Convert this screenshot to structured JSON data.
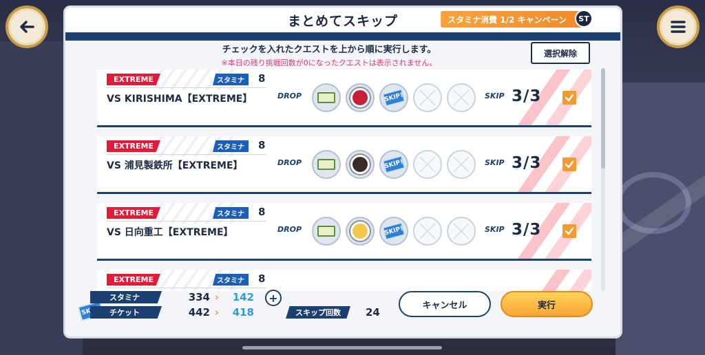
{
  "dialog": {
    "title": "まとめてスキップ",
    "campaign_badge": "スタミナ消費 1/2 キャンペーン",
    "campaign_st": "ST",
    "instruction": "チェックを入れたクエストを上から順に実行します。",
    "note": "※本日の残り挑戦回数が0になったクエストは表示されません。",
    "deselect_label": "選択解除"
  },
  "labels": {
    "stamina": "スタミナ",
    "drop": "DROP",
    "skip": "SKIP",
    "skip_ticket": "SKIP!"
  },
  "quests": [
    {
      "difficulty": "EXTREME",
      "stamina": "8",
      "name": "VS KIRISHIMA【EXTREME】",
      "drops": [
        "ticket",
        "emblem-red",
        "skip-ticket",
        "empty",
        "empty"
      ],
      "skip_count": "3/3",
      "checked": true
    },
    {
      "difficulty": "EXTREME",
      "stamina": "8",
      "name": "VS 浦見製鉄所【EXTREME】",
      "drops": [
        "ticket",
        "emblem-dark",
        "skip-ticket",
        "empty",
        "empty"
      ],
      "skip_count": "3/3",
      "checked": true
    },
    {
      "difficulty": "EXTREME",
      "stamina": "8",
      "name": "VS 日向重工【EXTREME】",
      "drops": [
        "ticket",
        "emblem-gear",
        "skip-ticket",
        "empty",
        "empty"
      ],
      "skip_count": "3/3",
      "checked": true
    },
    {
      "difficulty": "EXTREME",
      "stamina": "8",
      "name": "",
      "drops": [],
      "skip_count": "",
      "checked": false
    }
  ],
  "footer": {
    "stamina_label": "スタミナ",
    "stamina_current": "334",
    "stamina_after": "142",
    "ticket_label": "チケット",
    "ticket_current": "442",
    "ticket_after": "418",
    "skip_count_label": "スキップ回数",
    "skip_count_value": "24",
    "cancel_label": "キャンセル",
    "execute_label": "実行",
    "arrow": "›",
    "plus": "+"
  },
  "colors": {
    "navy": "#1c3f72",
    "extreme_red": "#e31b3a",
    "accent_orange": "#f39b2f",
    "after_blue": "#2f9adf",
    "note_pink": "#e0357c"
  },
  "icons": {
    "back": "back-arrow-icon",
    "menu": "hamburger-menu-icon"
  }
}
